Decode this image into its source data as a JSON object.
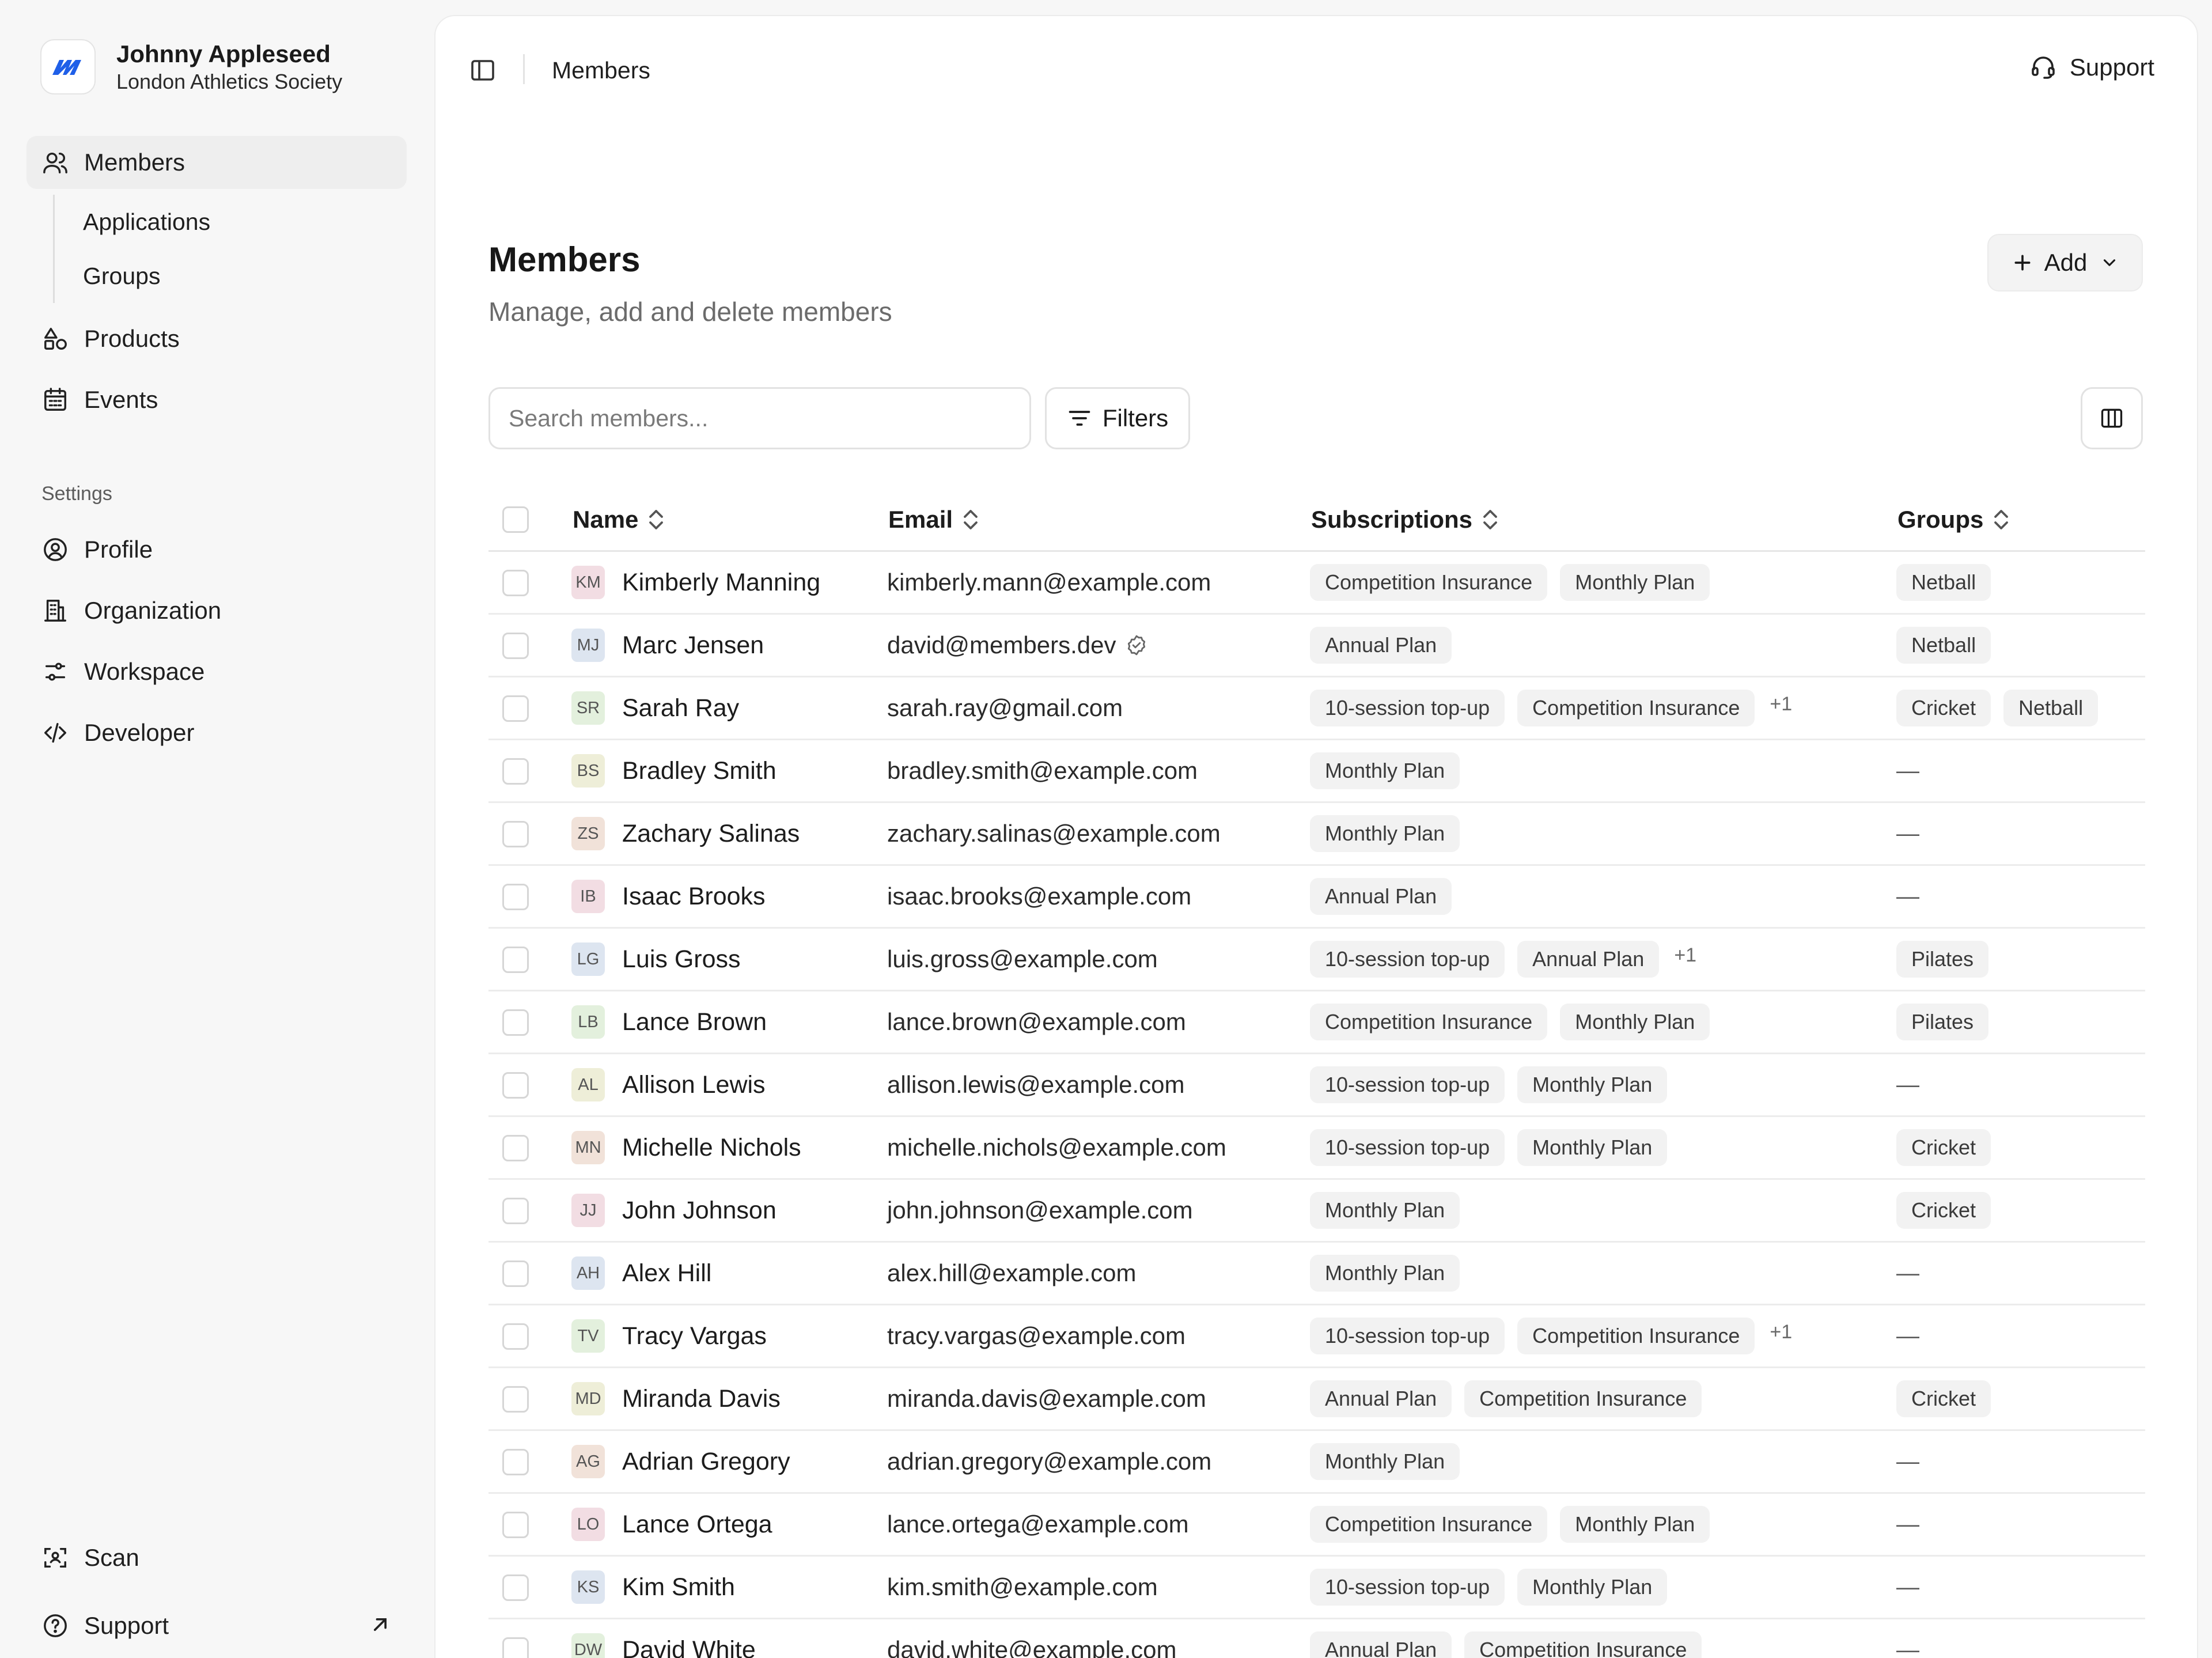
{
  "colors": {
    "brand_logo": "#1f5fe8",
    "accent_bg": "#eeeeee",
    "avatar_palette": [
      "#f2dde3",
      "#dde5f0",
      "#e3f0dd",
      "#eeeed8",
      "#f1e2d9"
    ]
  },
  "org": {
    "user_name": "Johnny Appleseed",
    "org_name": "London Athletics Society",
    "logo_icon": "brand-logo"
  },
  "sidebar": {
    "members_label": "Members",
    "applications_label": "Applications",
    "groups_label": "Groups",
    "products_label": "Products",
    "events_label": "Events",
    "settings_label": "Settings",
    "profile_label": "Profile",
    "organization_label": "Organization",
    "workspace_label": "Workspace",
    "developer_label": "Developer",
    "scan_label": "Scan",
    "support_label": "Support"
  },
  "topbar": {
    "breadcrumb": "Members",
    "support_label": "Support"
  },
  "page": {
    "title": "Members",
    "subtitle": "Manage, add and delete members",
    "add_label": "Add"
  },
  "search": {
    "placeholder": "Search members..."
  },
  "filters": {
    "label": "Filters"
  },
  "table": {
    "columns": {
      "name": "Name",
      "email": "Email",
      "subscriptions": "Subscriptions",
      "groups": "Groups"
    },
    "rows": [
      {
        "initials": "KM",
        "name": "Kimberly Manning",
        "email": "kimberly.mann@example.com",
        "subs": [
          "Competition Insurance",
          "Monthly Plan"
        ],
        "more": "",
        "groups": [
          "Netball"
        ],
        "verified": false
      },
      {
        "initials": "MJ",
        "name": "Marc Jensen",
        "email": "david@members.dev",
        "subs": [
          "Annual Plan"
        ],
        "more": "",
        "groups": [
          "Netball"
        ],
        "verified": true
      },
      {
        "initials": "SR",
        "name": "Sarah Ray",
        "email": "sarah.ray@gmail.com",
        "subs": [
          "10-session top-up",
          "Competition Insurance"
        ],
        "more": "+1",
        "groups": [
          "Cricket",
          "Netball"
        ],
        "verified": false
      },
      {
        "initials": "BS",
        "name": "Bradley Smith",
        "email": "bradley.smith@example.com",
        "subs": [
          "Monthly Plan"
        ],
        "more": "",
        "groups": [],
        "verified": false
      },
      {
        "initials": "ZS",
        "name": "Zachary Salinas",
        "email": "zachary.salinas@example.com",
        "subs": [
          "Monthly Plan"
        ],
        "more": "",
        "groups": [],
        "verified": false
      },
      {
        "initials": "IB",
        "name": "Isaac Brooks",
        "email": "isaac.brooks@example.com",
        "subs": [
          "Annual Plan"
        ],
        "more": "",
        "groups": [],
        "verified": false
      },
      {
        "initials": "LG",
        "name": "Luis Gross",
        "email": "luis.gross@example.com",
        "subs": [
          "10-session top-up",
          "Annual Plan"
        ],
        "more": "+1",
        "groups": [
          "Pilates"
        ],
        "verified": false
      },
      {
        "initials": "LB",
        "name": "Lance Brown",
        "email": "lance.brown@example.com",
        "subs": [
          "Competition Insurance",
          "Monthly Plan"
        ],
        "more": "",
        "groups": [
          "Pilates"
        ],
        "verified": false
      },
      {
        "initials": "AL",
        "name": "Allison Lewis",
        "email": "allison.lewis@example.com",
        "subs": [
          "10-session top-up",
          "Monthly Plan"
        ],
        "more": "",
        "groups": [],
        "verified": false
      },
      {
        "initials": "MN",
        "name": "Michelle Nichols",
        "email": "michelle.nichols@example.com",
        "subs": [
          "10-session top-up",
          "Monthly Plan"
        ],
        "more": "",
        "groups": [
          "Cricket"
        ],
        "verified": false
      },
      {
        "initials": "JJ",
        "name": "John Johnson",
        "email": "john.johnson@example.com",
        "subs": [
          "Monthly Plan"
        ],
        "more": "",
        "groups": [
          "Cricket"
        ],
        "verified": false
      },
      {
        "initials": "AH",
        "name": "Alex Hill",
        "email": "alex.hill@example.com",
        "subs": [
          "Monthly Plan"
        ],
        "more": "",
        "groups": [],
        "verified": false
      },
      {
        "initials": "TV",
        "name": "Tracy Vargas",
        "email": "tracy.vargas@example.com",
        "subs": [
          "10-session top-up",
          "Competition Insurance"
        ],
        "more": "+1",
        "groups": [],
        "verified": false
      },
      {
        "initials": "MD",
        "name": "Miranda Davis",
        "email": "miranda.davis@example.com",
        "subs": [
          "Annual Plan",
          "Competition Insurance"
        ],
        "more": "",
        "groups": [
          "Cricket"
        ],
        "verified": false
      },
      {
        "initials": "AG",
        "name": "Adrian Gregory",
        "email": "adrian.gregory@example.com",
        "subs": [
          "Monthly Plan"
        ],
        "more": "",
        "groups": [],
        "verified": false
      },
      {
        "initials": "LO",
        "name": "Lance Ortega",
        "email": "lance.ortega@example.com",
        "subs": [
          "Competition Insurance",
          "Monthly Plan"
        ],
        "more": "",
        "groups": [],
        "verified": false
      },
      {
        "initials": "KS",
        "name": "Kim Smith",
        "email": "kim.smith@example.com",
        "subs": [
          "10-session top-up",
          "Monthly Plan"
        ],
        "more": "",
        "groups": [],
        "verified": false
      },
      {
        "initials": "DW",
        "name": "David White",
        "email": "david.white@example.com",
        "subs": [
          "Annual Plan",
          "Competition Insurance"
        ],
        "more": "",
        "groups": [],
        "verified": false
      }
    ],
    "empty_group": "—"
  }
}
